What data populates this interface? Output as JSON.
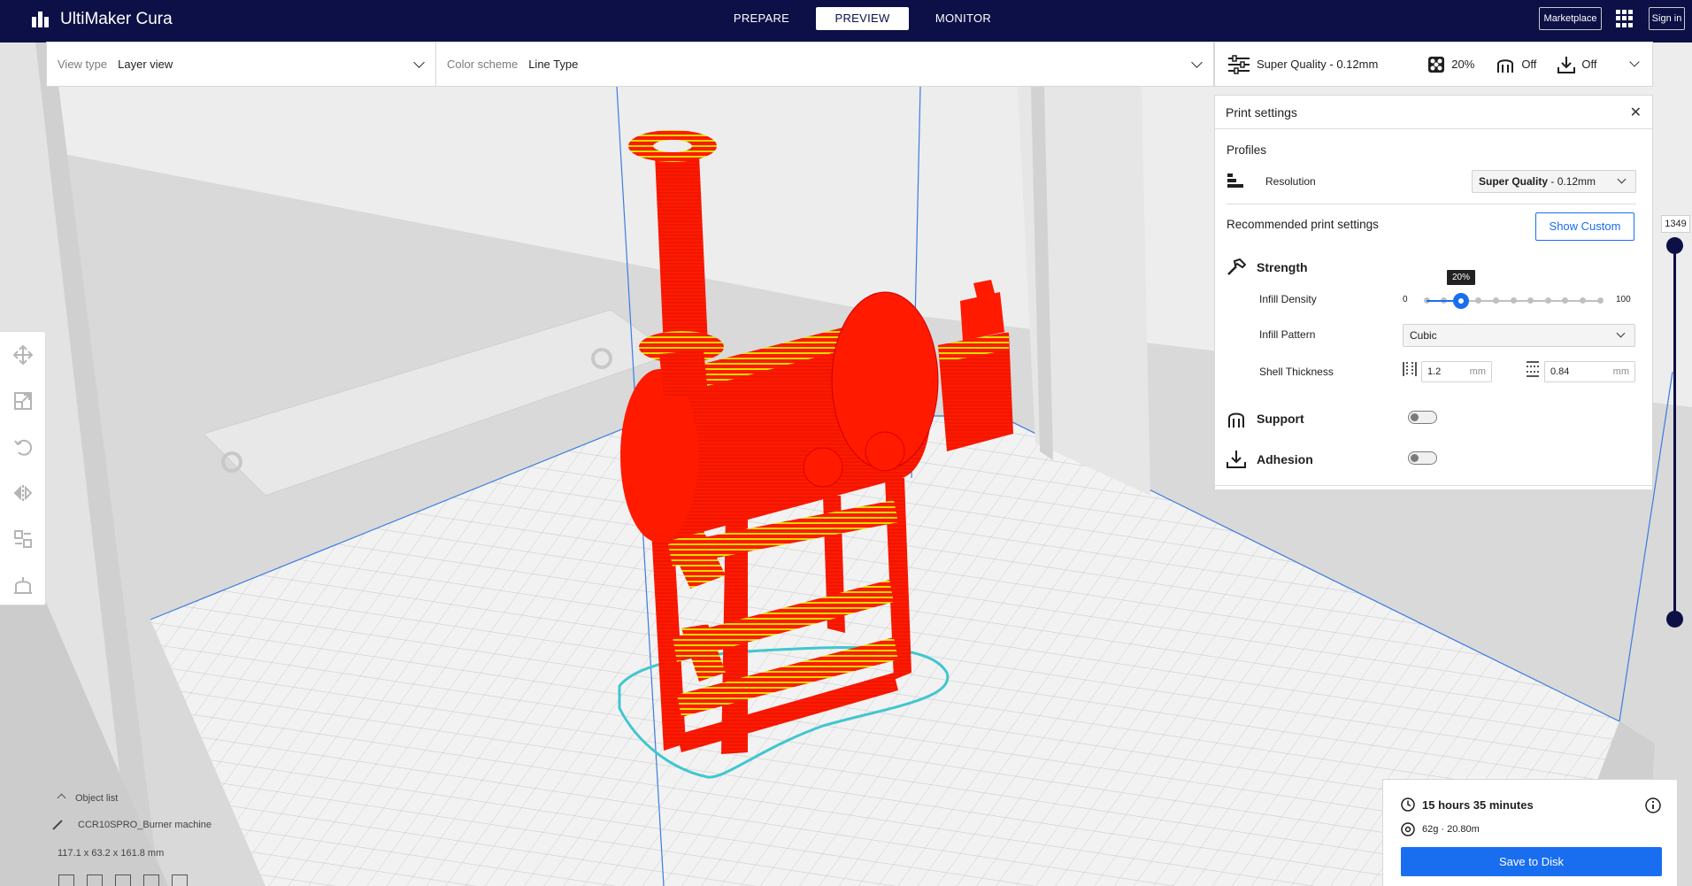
{
  "app": {
    "title": "UltiMaker Cura"
  },
  "nav": {
    "tabs": [
      "PREPARE",
      "PREVIEW",
      "MONITOR"
    ],
    "active": "PREVIEW"
  },
  "header": {
    "marketplace": "Marketplace",
    "signin": "Sign in"
  },
  "viewbar": {
    "view_type_label": "View type",
    "view_type_value": "Layer view",
    "color_scheme_label": "Color scheme",
    "color_scheme_value": "Line Type"
  },
  "quality_bar": {
    "profile": "Super Quality - 0.12mm",
    "infill": "20%",
    "support": "Off",
    "adhesion": "Off"
  },
  "print_settings": {
    "title": "Print settings",
    "profiles_label": "Profiles",
    "resolution_label": "Resolution",
    "resolution_bold": "Super Quality",
    "resolution_rest": " - 0.12mm",
    "recommended_label": "Recommended print settings",
    "show_custom": "Show Custom",
    "strength_label": "Strength",
    "infill_density_label": "Infill Density",
    "infill_min": "0",
    "infill_max": "100",
    "infill_value_label": "20%",
    "infill_value_fraction": 0.2,
    "infill_pattern_label": "Infill Pattern",
    "infill_pattern_value": "Cubic",
    "shell_thickness_label": "Shell Thickness",
    "wall_thickness": "1.2",
    "top_bottom_thickness": "0.84",
    "unit": "mm",
    "support_label": "Support",
    "support_enabled": false,
    "adhesion_label": "Adhesion",
    "adhesion_enabled": false
  },
  "layer_slider": {
    "value": "1349"
  },
  "object_list": {
    "header": "Object list",
    "object_name": "CCR10SPRO_Burner machine",
    "dimensions": "117.1 x 63.2 x 161.8 mm"
  },
  "print_info": {
    "time": "15 hours 35 minutes",
    "material": "62g · 20.80m",
    "save_button": "Save to Disk"
  },
  "colors": {
    "header_bg": "#0c1046",
    "accent": "#196ef0",
    "model_red": "#ff1a00",
    "infill_yellow": "#e2e200",
    "skirt_cyan": "#41c6cf"
  }
}
